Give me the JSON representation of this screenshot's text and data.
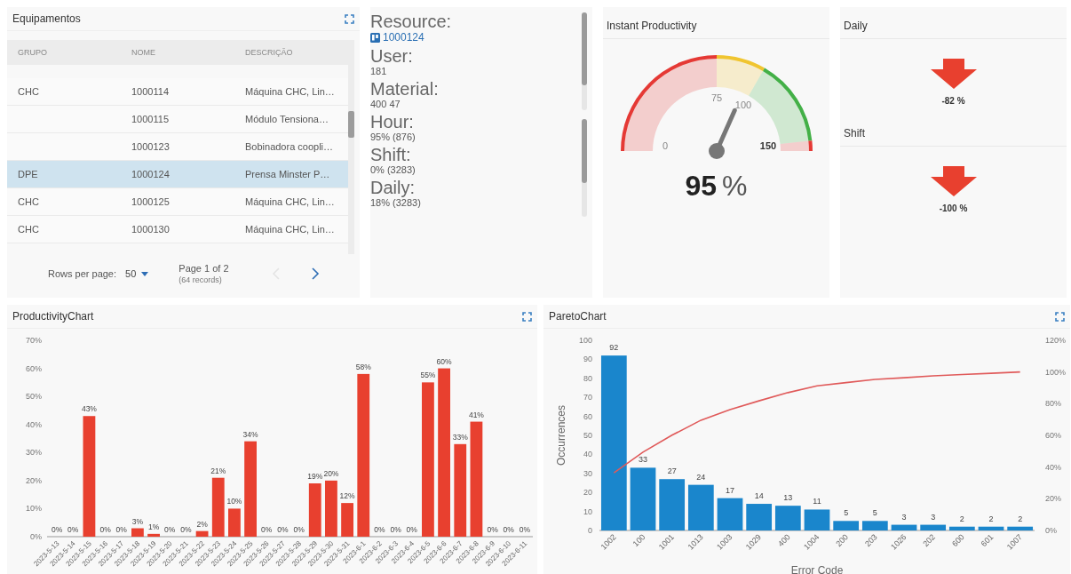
{
  "equipment_panel": {
    "title": "Equipamentos",
    "columns": [
      "GRUPO",
      "NOME",
      "DESCRIÇÃO"
    ],
    "rows": [
      {
        "group": "CHC",
        "name": "1000114",
        "description": "Máquina CHC, Lin…",
        "selected": false
      },
      {
        "name": "1000115",
        "description": "Módulo Tensiona…",
        "selected": false
      },
      {
        "name": "1000123",
        "description": "Bobinadora coopli…",
        "selected": false
      },
      {
        "group": "DPE",
        "name": "1000124",
        "description": "Prensa Minster P…",
        "selected": true
      },
      {
        "group": "CHC",
        "name": "1000125",
        "description": "Máquina CHC, Lin…",
        "selected": false
      },
      {
        "group": "CHC",
        "name": "1000130",
        "description": "Máquina CHC, Lin…",
        "selected": false
      }
    ],
    "pagination": {
      "rows_per_page_label": "Rows per page:",
      "rows_per_page": "50",
      "page": "Page 1 of 2",
      "records": "(64 records)",
      "previous_disabled": true,
      "next_disabled": false
    }
  },
  "resource_info": [
    {
      "label": "Resource:",
      "value": "1000124",
      "kind": "link"
    },
    {
      "label": "User:",
      "value": "181",
      "kind": "text"
    },
    {
      "label": "Material:",
      "value": "400 47",
      "kind": "text"
    },
    {
      "label": "Hour:",
      "value": "95% (876)",
      "kind": "text"
    },
    {
      "label": "Shift:",
      "value": "0% (3283)",
      "kind": "text"
    },
    {
      "label": "Daily:",
      "value": "18% (3283)",
      "kind": "text"
    }
  ],
  "gauge": {
    "title": "Instant Productivity",
    "value": "95",
    "unit": "%",
    "ticks": [
      "0",
      "75",
      "100",
      "150"
    ]
  },
  "trends": [
    {
      "title": "Daily",
      "kind": "decrease",
      "value": "-82 %"
    },
    {
      "title": "Shift",
      "kind": "decrease",
      "value": "-100 %"
    }
  ],
  "productivity_panel": {
    "title": "ProductivityChart",
    "chart_data": {
      "type": "bar",
      "categories": [
        "2023-5-13",
        "2023-5-14",
        "2023-5-15",
        "2023-5-16",
        "2023-5-17",
        "2023-5-18",
        "2023-5-19",
        "2023-5-20",
        "2023-5-21",
        "2023-5-22",
        "2023-5-23",
        "2023-5-24",
        "2023-5-25",
        "2023-5-26",
        "2023-5-27",
        "2023-5-28",
        "2023-5-29",
        "2023-5-30",
        "2023-5-31",
        "2023-6-1",
        "2023-6-2",
        "2023-6-3",
        "2023-6-4",
        "2023-6-5",
        "2023-6-6",
        "2023-6-7",
        "2023-6-8",
        "2023-6-9",
        "2023-6-10",
        "2023-6-11"
      ],
      "series": [
        {
          "color": "#e8402f",
          "values": [
            0,
            0,
            43,
            0,
            0,
            3,
            1,
            0,
            0,
            2,
            21,
            10,
            34,
            0,
            0,
            0,
            19,
            20,
            12,
            58,
            0,
            0,
            0,
            55,
            60,
            33,
            41,
            0,
            0,
            0
          ]
        }
      ],
      "value_labels": [
        "0%",
        "0%",
        "43%",
        "0%",
        "0%",
        "3%",
        "1%",
        "0%",
        "0%",
        "2%",
        "21%",
        "10%",
        "34%",
        "0%",
        "0%",
        "0%",
        "19%",
        "20%",
        "12%",
        "58%",
        "0%",
        "0%",
        "0%",
        "55%",
        "60%",
        "33%",
        "41%",
        "0%",
        "0%",
        "0%"
      ],
      "ylim": [
        0,
        70
      ],
      "yticks": [
        {
          "value": 0,
          "label": "0%"
        },
        {
          "value": 10,
          "label": "10%"
        },
        {
          "value": 20,
          "label": "20%"
        },
        {
          "value": 30,
          "label": "30%"
        },
        {
          "value": 40,
          "label": "40%"
        },
        {
          "value": 50,
          "label": "50%"
        },
        {
          "value": 60,
          "label": "60%"
        },
        {
          "value": 70,
          "label": "70%"
        }
      ]
    }
  },
  "pareto_panel": {
    "title": "ParetoChart",
    "chart_data": {
      "type": "bar",
      "xlabel": "Error Code",
      "ylabel": "Occurrences",
      "categories": [
        "1002",
        "100",
        "1001",
        "1013",
        "1003",
        "1029",
        "400",
        "1004",
        "200",
        "203",
        "1026",
        "202",
        "600",
        "601",
        "1007"
      ],
      "series": [
        {
          "type": "bar",
          "color": "#1a86cc",
          "values": [
            92,
            33,
            27,
            24,
            17,
            14,
            13,
            11,
            5,
            5,
            3,
            3,
            2,
            2,
            2
          ]
        },
        {
          "type": "line",
          "axis": "y2",
          "color": "#e05a5a",
          "values": [
            36.4,
            49.4,
            60.1,
            69.6,
            76.3,
            81.8,
            87.0,
            91.3,
            93.3,
            95.3,
            96.4,
            97.6,
            98.4,
            99.2,
            100
          ]
        }
      ],
      "value_labels": [
        "92",
        "33",
        "27",
        "24",
        "17",
        "14",
        "13",
        "11",
        "5",
        "5",
        "3",
        "3",
        "2",
        "2",
        "2"
      ],
      "ylim": [
        0,
        100
      ],
      "yticks": [
        0,
        10,
        20,
        30,
        40,
        50,
        60,
        70,
        80,
        90,
        100
      ],
      "y2lim": [
        0,
        120
      ],
      "y2ticks": [
        {
          "value": 0,
          "label": "0%"
        },
        {
          "value": 20,
          "label": "20%"
        },
        {
          "value": 40,
          "label": "40%"
        },
        {
          "value": 60,
          "label": "60%"
        },
        {
          "value": 80,
          "label": "80%"
        },
        {
          "value": 100,
          "label": "100%"
        },
        {
          "value": 120,
          "label": "120%"
        }
      ]
    }
  }
}
